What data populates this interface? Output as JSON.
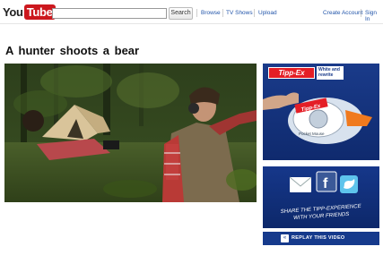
{
  "header": {
    "logo_you": "You",
    "logo_tube": "Tube",
    "search_button": "Search",
    "search_value": "",
    "nav": {
      "browse": "Browse",
      "tv_shows": "TV Shows",
      "upload": "Upload",
      "create_account": "Create Account",
      "sign_in": "Sign In"
    }
  },
  "video": {
    "title": "A hunter  shoots  a bear"
  },
  "ads": {
    "tippex": {
      "brand": "Tipp-Ex",
      "tagline": "White and rewrite",
      "product_brand": "Tipp-Ex",
      "product_name": "Pocket Mouse"
    },
    "share": {
      "text_line1": "SHARE THE TIPP-EXPERIENCE",
      "text_line2": "WITH YOUR FRIENDS",
      "facebook_label": "f"
    },
    "replay": {
      "label": "REPLAY THIS VIDEO",
      "icon_glyph": "«"
    }
  },
  "colors": {
    "youtube_red": "#cc181e",
    "link_blue": "#2255aa",
    "ad_blue": "#163a8c",
    "tippex_red": "#e41e26"
  }
}
